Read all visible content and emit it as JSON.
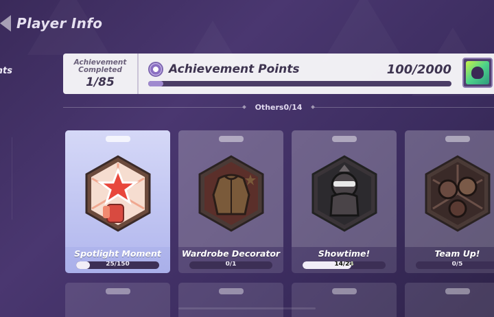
{
  "header": {
    "title": "Player Info"
  },
  "sidebar": {
    "active_tab_label": "nts"
  },
  "summary": {
    "completed_label": "Achievement Completed",
    "completed_count": "1/85",
    "points_title": "Achievement Points",
    "points_value": "100/2000",
    "points_progress": 0.05
  },
  "section": {
    "label": "Others0/14"
  },
  "achievements": [
    {
      "name": "Spotlight Moment",
      "progress_text": "25/150",
      "progress": 0.167,
      "active": true
    },
    {
      "name": "Wardrobe Decorator",
      "progress_text": "0/1",
      "progress": 0,
      "active": false
    },
    {
      "name": "Showtime!",
      "progress_text": "14/24",
      "progress": 0.583,
      "active": false
    },
    {
      "name": "Team Up!",
      "progress_text": "0/5",
      "progress": 0,
      "active": false
    }
  ],
  "colors": {
    "background": "#3b2c5e",
    "panel": "#f2f0f6",
    "accent": "#9f89cf",
    "active_card": "#b7bcef"
  }
}
